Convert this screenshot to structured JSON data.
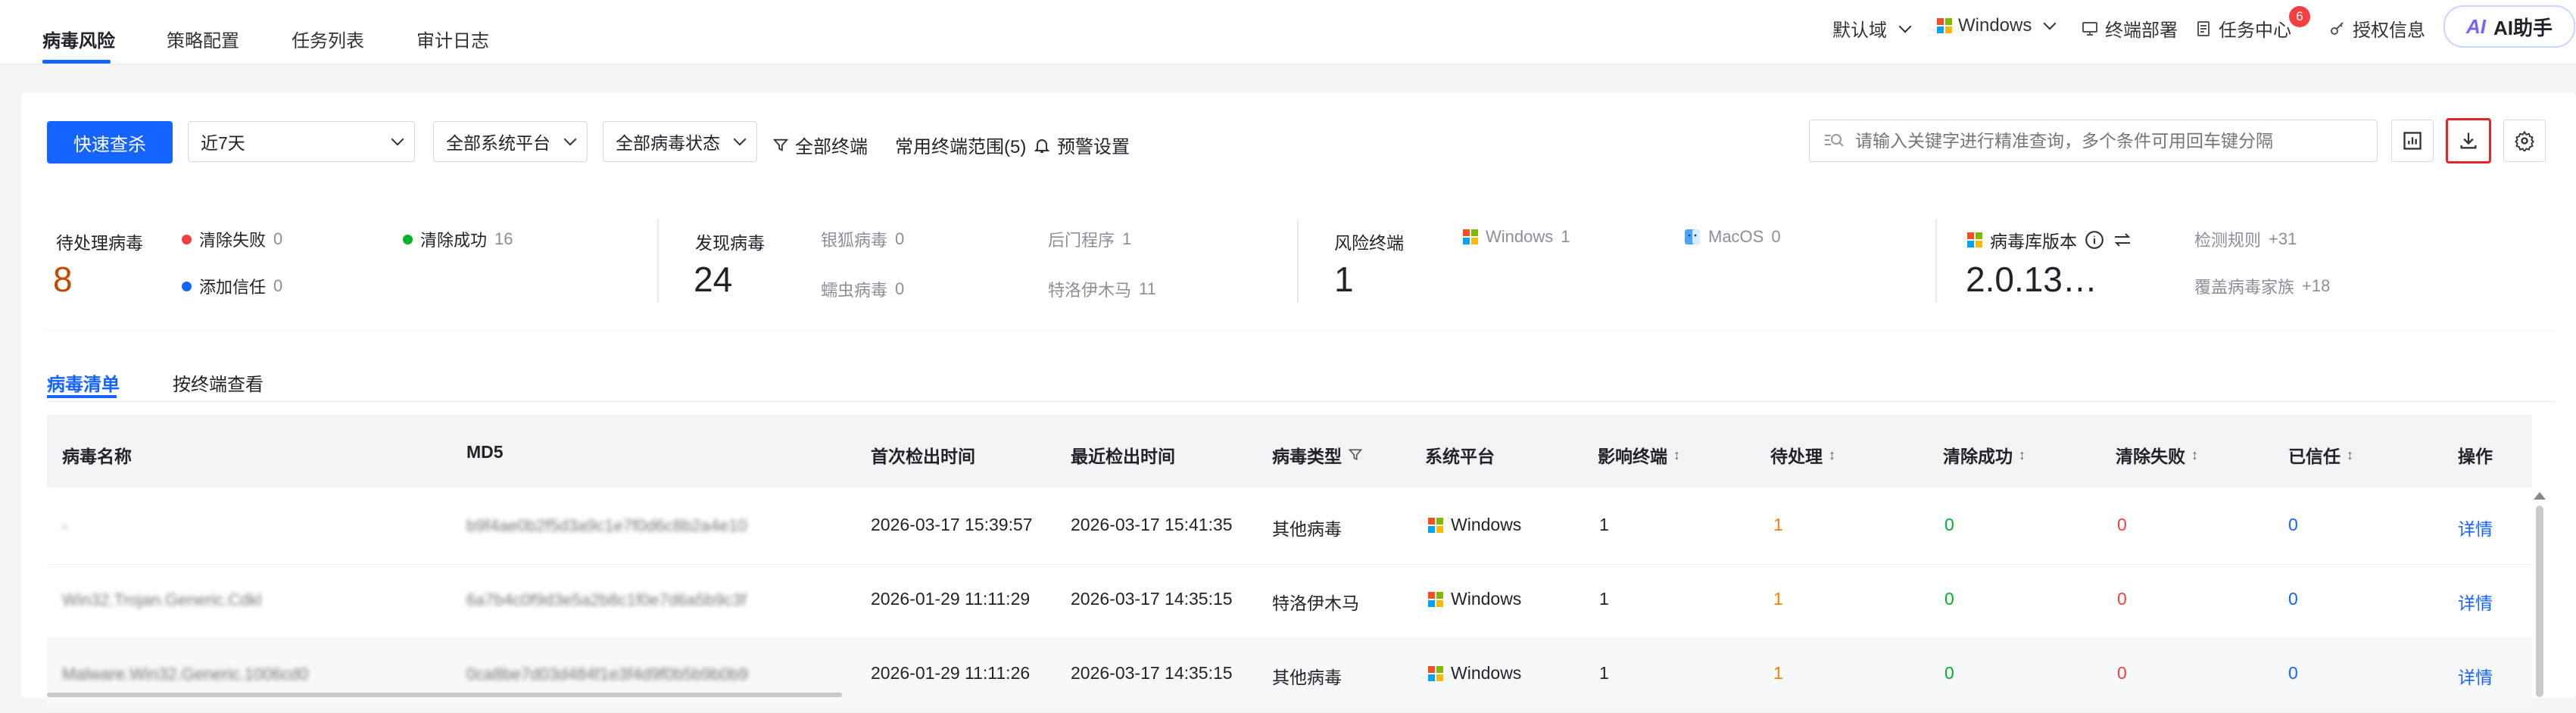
{
  "nav": {
    "tabs": [
      {
        "label": "病毒风险",
        "active": true
      },
      {
        "label": "策略配置",
        "active": false
      },
      {
        "label": "任务列表",
        "active": false
      },
      {
        "label": "审计日志",
        "active": false
      }
    ],
    "domain_selector": "默认域",
    "platform_selector": "Windows",
    "terminal_deploy": "终端部署",
    "task_center": "任务中心",
    "task_center_badge": "6",
    "license_info": "授权信息",
    "ai_assistant": "AI助手",
    "ai_logo": "AI"
  },
  "toolbar": {
    "quick_search": "快速查杀",
    "time_range": "近7天",
    "system_platform": "全部系统平台",
    "virus_status": "全部病毒状态",
    "filter_all_terminals": "全部终端",
    "common_range": "常用终端范围(5)",
    "alert_settings": "预警设置",
    "search_placeholder": "请输入关键字进行精准查询，多个条件可用回车键分隔"
  },
  "stats": {
    "pending": {
      "label": "待处理病毒",
      "value": "8",
      "clear_failed_label": "清除失败",
      "clear_failed_value": "0",
      "clear_success_label": "清除成功",
      "clear_success_value": "16",
      "add_trust_label": "添加信任",
      "add_trust_value": "0"
    },
    "found": {
      "label": "发现病毒",
      "value": "24",
      "ransomware_label": "银狐病毒",
      "ransomware_value": "0",
      "backdoor_label": "后门程序",
      "backdoor_value": "1",
      "worm_label": "蠕虫病毒",
      "worm_value": "0",
      "trojan_label": "特洛伊木马",
      "trojan_value": "11"
    },
    "risk_terminals": {
      "label": "风险终端",
      "value": "1",
      "windows_label": "Windows",
      "windows_value": "1",
      "macos_label": "MacOS",
      "macos_value": "0"
    },
    "virus_db": {
      "label": "病毒库版本",
      "value": "2.0.13…",
      "rules_label": "检测规则",
      "rules_value": "+31",
      "families_label": "覆盖病毒家族",
      "families_value": "+18"
    }
  },
  "subtabs": [
    {
      "label": "病毒清单",
      "active": true
    },
    {
      "label": "按终端查看",
      "active": false
    }
  ],
  "table": {
    "headers": {
      "name": "病毒名称",
      "md5": "MD5",
      "first_seen": "首次检出时间",
      "last_seen": "最近检出时间",
      "type": "病毒类型",
      "platform": "系统平台",
      "affected": "影响终端",
      "pending": "待处理",
      "cleared": "清除成功",
      "failed": "清除失败",
      "trusted": "已信任",
      "action": "操作"
    },
    "rows": [
      {
        "name": "-",
        "md5": "b9f4ae0b2f5d3a9c1e7f0d6c8b2a4e10",
        "first_seen": "2026-03-17 15:39:57",
        "last_seen": "2026-03-17 15:41:35",
        "type": "其他病毒",
        "platform": "Windows",
        "affected": "1",
        "pending": "1",
        "cleared": "0",
        "failed": "0",
        "trusted": "0",
        "action": "详情"
      },
      {
        "name": "Win32.Trojan.Generic.Cdkl",
        "md5": "6a7b4c0f9d3e5a2b8c1f0e7d6a5b9c3f",
        "first_seen": "2026-01-29 11:11:29",
        "last_seen": "2026-03-17 14:35:15",
        "type": "特洛伊木马",
        "platform": "Windows",
        "affected": "1",
        "pending": "1",
        "cleared": "0",
        "failed": "0",
        "trusted": "0",
        "action": "详情"
      },
      {
        "name": "Malware.Win32.Generic.1006cd0",
        "md5": "0ca8be7d03d484f1e3f4d9f0b5b9b0b9",
        "first_seen": "2026-01-29 11:11:26",
        "last_seen": "2026-03-17 14:35:15",
        "type": "其他病毒",
        "platform": "Windows",
        "affected": "1",
        "pending": "1",
        "cleared": "0",
        "failed": "0",
        "trusted": "0",
        "action": "详情"
      }
    ]
  },
  "colors": {
    "primary": "#1664ff",
    "pending": "#ff7d00",
    "success": "#00b42a",
    "fail": "#f53f3f",
    "highlight_border": "#e0252d"
  }
}
